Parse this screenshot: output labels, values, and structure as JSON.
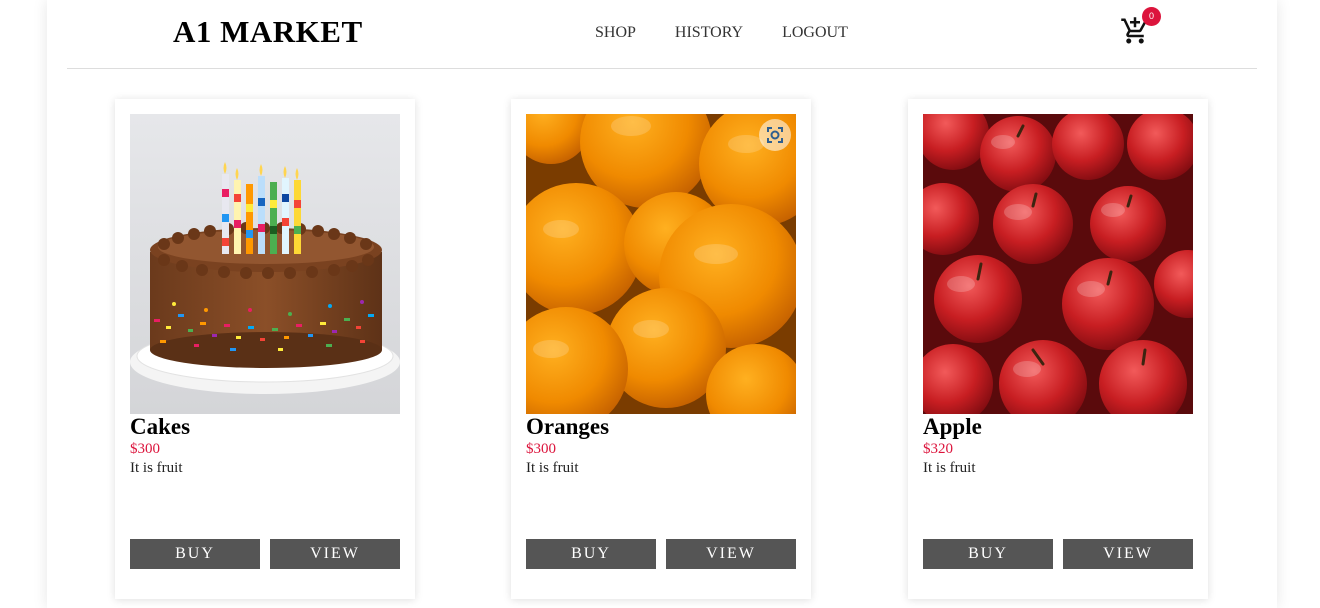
{
  "header": {
    "brand": "A1 MARKET",
    "nav": [
      "SHOP",
      "HISTORY",
      "LOGOUT"
    ],
    "cart_count": "0",
    "cart_icon": "add-shopping-cart-icon"
  },
  "colors": {
    "price": "#dc143c",
    "badge": "#dc143c",
    "button_bg": "#555555"
  },
  "products": [
    {
      "name": "Cakes",
      "price": "$300",
      "description": "It is fruit",
      "buy_label": "BUY",
      "view_label": "VIEW"
    },
    {
      "name": "Oranges",
      "price": "$300",
      "description": "It is fruit",
      "buy_label": "BUY",
      "view_label": "VIEW"
    },
    {
      "name": "Apple",
      "price": "$320",
      "description": "It is fruit",
      "buy_label": "BUY",
      "view_label": "VIEW"
    }
  ]
}
